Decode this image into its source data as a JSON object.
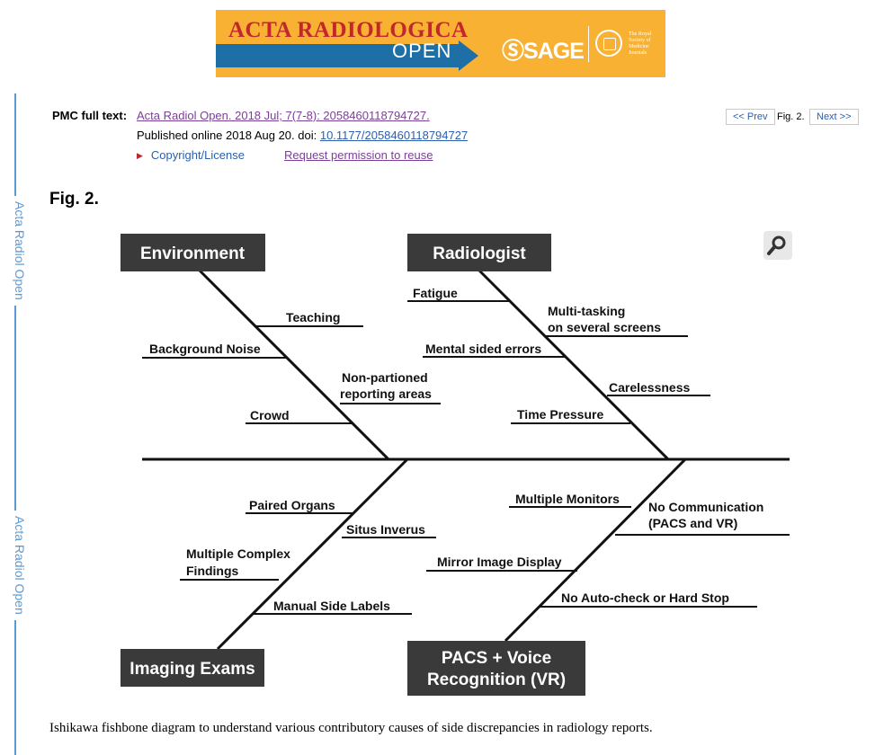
{
  "banner": {
    "journal_name": "ACTA RADIOLOGICA",
    "open_label": "OPEN",
    "publisher": "SAGE",
    "society_text": "The Royal Society of Medicine Journals",
    "colors": {
      "background": "#f8b133",
      "arrow": "#1d6fa5",
      "title": "#c1272d"
    }
  },
  "side_rail": {
    "label": "Acta Radiol Open"
  },
  "citation": {
    "label": "PMC full text:",
    "journal_link": "Acta Radiol Open. 2018 Jul; 7(7-8): 2058460118794727.",
    "published_prefix": "Published online 2018 Aug 20. doi: ",
    "doi": "10.1177/2058460118794727",
    "copyright_link": "Copyright/License",
    "permission_link": "Request permission to reuse"
  },
  "pager": {
    "prev": "<< Prev",
    "current": "Fig. 2.",
    "next": "Next >>"
  },
  "figure": {
    "title": "Fig. 2.",
    "zoom_icon": "magnifier-icon",
    "caption": "Ishikawa fishbone diagram to understand various contributory causes of side discrepancies in radiology reports.",
    "categories": {
      "environment": "Environment",
      "radiologist": "Radiologist",
      "imaging_exams": "Imaging Exams",
      "pacs_line1": "PACS + Voice",
      "pacs_line2": "Recognition (VR)"
    },
    "causes": {
      "teaching": "Teaching",
      "background_noise": "Background Noise",
      "non_partioned_1": "Non-partioned",
      "non_partioned_2": "reporting areas",
      "crowd": "Crowd",
      "fatigue": "Fatigue",
      "multitasking_1": "Multi-tasking",
      "multitasking_2": "on several screens",
      "mental_sided_errors": "Mental sided errors",
      "carelessness": "Carelessness",
      "time_pressure": "Time Pressure",
      "paired_organs": "Paired Organs",
      "situs_inverus": "Situs Inverus",
      "multiple_complex_1": "Multiple Complex",
      "multiple_complex_2": "Findings",
      "manual_side_labels": "Manual Side Labels",
      "multiple_monitors": "Multiple Monitors",
      "no_communication_1": "No Communication",
      "no_communication_2": "(PACS and VR)",
      "mirror_image_display": "Mirror Image Display",
      "no_autocheck": "No Auto-check or Hard Stop"
    },
    "colors": {
      "box": "#3a3a3a",
      "line": "#111111"
    }
  }
}
